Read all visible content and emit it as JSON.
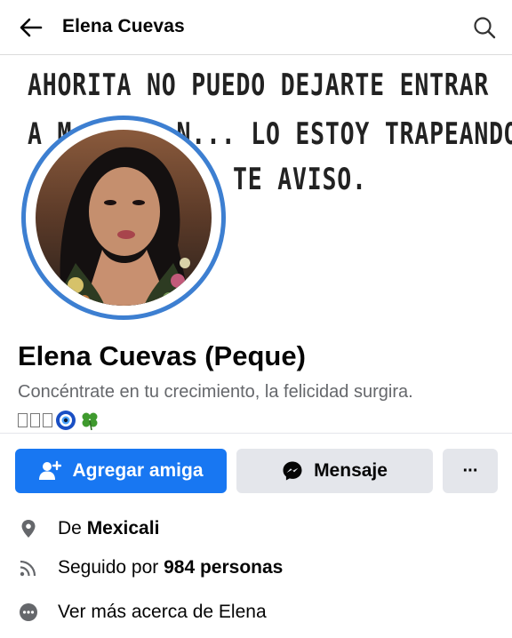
{
  "header": {
    "title": "Elena Cuevas",
    "back_icon": "arrow-left-icon",
    "search_icon": "search-icon"
  },
  "cover": {
    "line1": "AHORITA NO PUEDO DEJARTE ENTRAR",
    "line2": "A M... ...N... LO ESTOY TRAPEANDO.",
    "line3": "TE AVISO."
  },
  "profile": {
    "name": "Elena Cuevas (Peque)",
    "bio": "Concéntrate en tu crecimiento, la felicidad surgira.",
    "bio_icons": [
      "box-glyph",
      "box-glyph",
      "box-glyph",
      "evil-eye-icon",
      "clover-icon"
    ]
  },
  "actions": {
    "add_friend": "Agregar amiga",
    "message": "Mensaje",
    "more": "···"
  },
  "details": {
    "from_prefix": "De ",
    "from_value": "Mexicali",
    "followed_prefix": "Seguido por ",
    "followed_value": "984 personas",
    "see_more": "Ver más acerca de Elena"
  },
  "colors": {
    "accent": "#1877f2",
    "ring": "#3d7fd1",
    "secondary_button": "#e4e6eb",
    "muted_text": "#65676b"
  }
}
